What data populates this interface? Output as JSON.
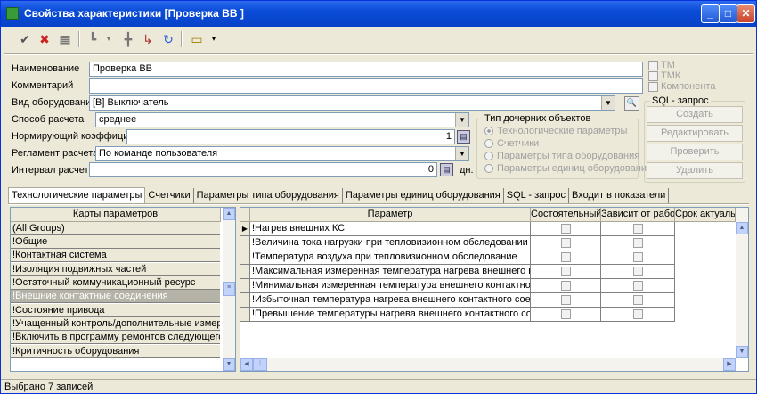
{
  "window": {
    "title": "Свойства характеристики [Проверка ВВ ]"
  },
  "toolbar": {
    "icons": [
      "checkmark-icon",
      "close-icon",
      "save-icon",
      "tree-icon",
      "add-icon",
      "move-icon",
      "refresh-icon",
      "form-icon"
    ]
  },
  "form": {
    "name_label": "Наименование",
    "name_value": "Проверка ВВ",
    "comment_label": "Комментарий",
    "comment_value": "",
    "equip_type_label": "Вид оборудования",
    "equip_type_value": "[В] Выключатель",
    "calc_method_label": "Способ расчета",
    "calc_method_value": "среднее",
    "norm_coef_label": "Нормирующий коэффициент",
    "norm_coef_value": "1",
    "regulation_label": "Регламент расчета",
    "regulation_value": "По команде пользователя",
    "interval_label": "Интервал расчета",
    "interval_value": "0",
    "interval_unit": "дн."
  },
  "flags": {
    "tm": "ТМ",
    "tmk": "ТМК",
    "component": "Компонента"
  },
  "child_type": {
    "title": "Тип дочерних объектов",
    "options": [
      "Технологические параметры",
      "Счетчики",
      "Параметры типа оборудования",
      "Параметры единиц оборудования"
    ]
  },
  "sql": {
    "title": "SQL- запрос",
    "create": "Создать",
    "edit": "Редактировать",
    "check": "Проверить",
    "delete": "Удалить"
  },
  "tabs": [
    "Технологические параметры",
    "Счетчики",
    "Параметры типа оборудования",
    "Параметры единиц оборудования",
    "SQL - запрос",
    "Входит в показатели"
  ],
  "left_grid": {
    "header": "Карты параметров",
    "rows": [
      "(All Groups)",
      "!Общие",
      "!Контактная система",
      "!Изоляция подвижных частей",
      "!Остаточный коммуникационный ресурс",
      "!Внешние контактные соединения",
      "!Состояние привода",
      "!Учащенный контроль/дополнительные измерения",
      "!Включить в программу ремонтов следующего года",
      "!Критичность оборудования"
    ],
    "selected_index": 5
  },
  "right_grid": {
    "headers": [
      "Параметр",
      "Состоятельный",
      "Зависит от работ",
      "Срок актуально"
    ],
    "rows": [
      "!Нагрев внешних КС",
      "!Величина тока нагрузки при тепловизионном обследовании",
      "!Температура воздуха при тепловизионном обследование",
      "!Максимальная измеренная температура нагрева внешнего контакт...",
      "!Минимальная измеренная температура внешнего контактного соеди...",
      "!Избыточная температура нагрева внешнего контактного соединения",
      "!Превышение температуры нагрева внешнего контактного соединен..."
    ]
  },
  "status": {
    "text": "Выбрано 7 записей"
  }
}
